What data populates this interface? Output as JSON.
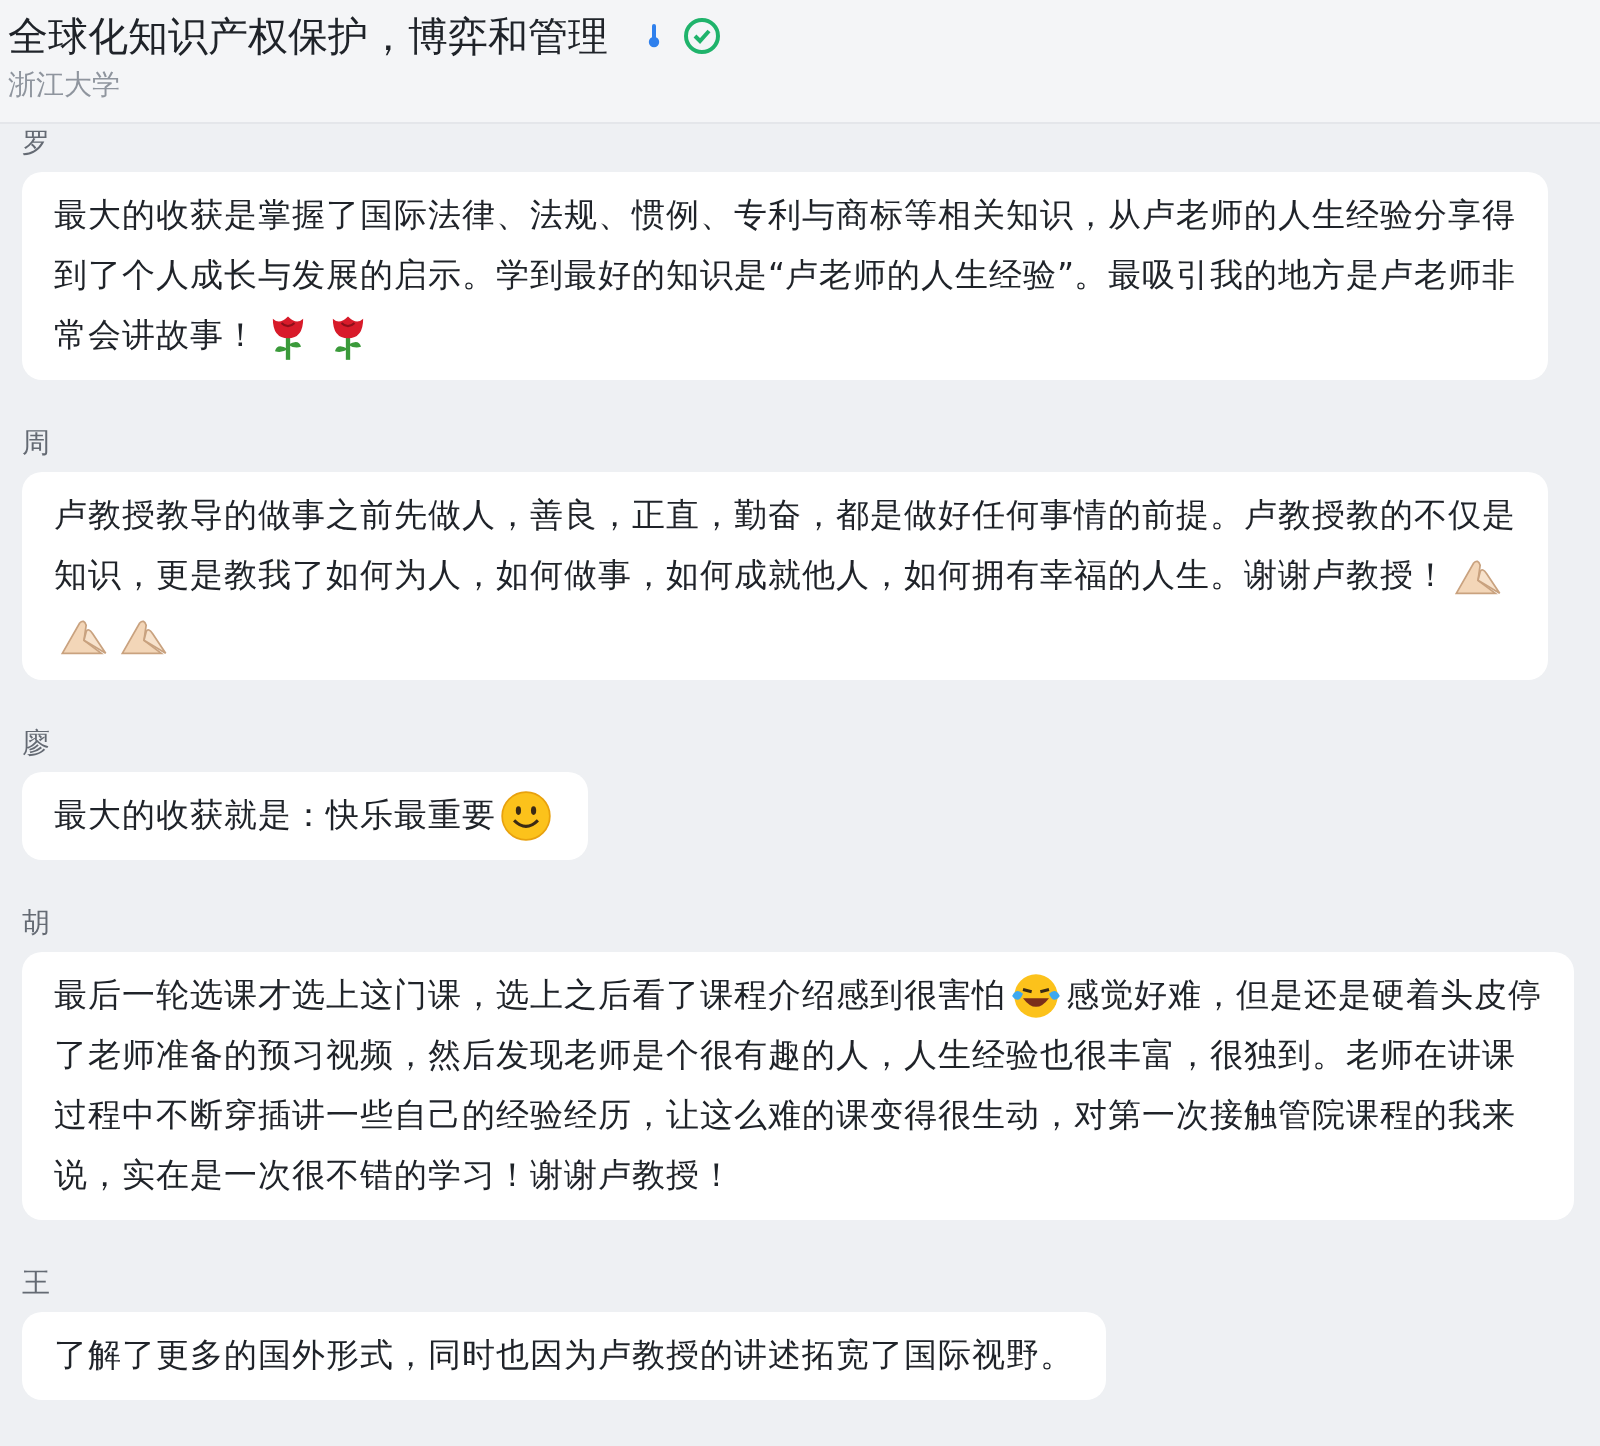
{
  "header": {
    "title": "全球化知识产权保护，博弈和管理",
    "subtitle": "浙江大学"
  },
  "messages": [
    {
      "sender": "罗",
      "lines": [
        [
          {
            "kind": "text",
            "text": "最大的收获是掌握了国际法律、法规、惯例、专利与商标等相关知识，从卢老师的人生经验分享得"
          }
        ],
        [
          {
            "kind": "text",
            "text": "到了个人成长与发展的启示。学到最好的知识是“卢老师的人生经验”。最吸引我的地方是卢老师非"
          }
        ],
        [
          {
            "kind": "text",
            "text": "常会讲故事！"
          },
          {
            "kind": "rose"
          },
          {
            "kind": "rose"
          }
        ]
      ]
    },
    {
      "sender": "周",
      "lines": [
        [
          {
            "kind": "text",
            "text": "卢教授教导的做事之前先做人，善良，正直，勤奋，都是做好任何事情的前提。卢教授教的不仅是"
          }
        ],
        [
          {
            "kind": "text",
            "text": "知识，更是教我了如何为人，如何做事，如何成就他人，如何拥有幸福的人生。谢谢卢教授！"
          },
          {
            "kind": "hands"
          }
        ],
        [
          {
            "kind": "hands"
          },
          {
            "kind": "hands"
          }
        ]
      ]
    },
    {
      "sender": "廖",
      "lines": [
        [
          {
            "kind": "text",
            "text": "最大的收获就是：快乐最重要"
          },
          {
            "kind": "smile"
          }
        ]
      ]
    },
    {
      "sender": "胡",
      "lines": [
        [
          {
            "kind": "text",
            "text": "最后一轮选课才选上这门课，选上之后看了课程介绍感到很害怕"
          },
          {
            "kind": "laugh"
          },
          {
            "kind": "text",
            "text": "感觉好难，但是还是硬着头皮停"
          }
        ],
        [
          {
            "kind": "text",
            "text": "了老师准备的预习视频，然后发现老师是个很有趣的人，人生经验也很丰富，很独到。老师在讲课"
          }
        ],
        [
          {
            "kind": "text",
            "text": "过程中不断穿插讲一些自己的经验经历，让这么难的课变得很生动，对第一次接触管院课程的我来"
          }
        ],
        [
          {
            "kind": "text",
            "text": "说，实在是一次很不错的学习！谢谢卢教授！"
          }
        ]
      ]
    },
    {
      "sender": "王",
      "lines": [
        [
          {
            "kind": "text",
            "text": "了解了更多的国外形式，同时也因为卢教授的讲述拓宽了国际视野。"
          }
        ]
      ]
    }
  ]
}
